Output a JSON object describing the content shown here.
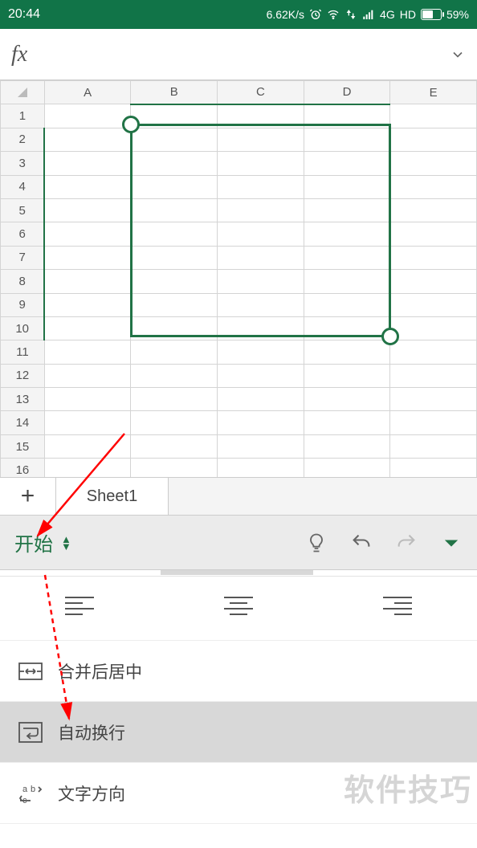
{
  "status": {
    "time": "20:44",
    "speed": "6.62K/s",
    "network": "4G",
    "hd": "HD",
    "battery_pct": "59%"
  },
  "formula_bar": {
    "fx_label": "fx"
  },
  "grid": {
    "columns": [
      "A",
      "B",
      "C",
      "D",
      "E"
    ],
    "rows": [
      "1",
      "2",
      "3",
      "4",
      "5",
      "6",
      "7",
      "8",
      "9",
      "10",
      "11",
      "12",
      "13",
      "14",
      "15",
      "16"
    ],
    "selected_cols": [
      "B",
      "C",
      "D"
    ],
    "selected_rows": [
      "2",
      "3",
      "4",
      "5",
      "6",
      "7",
      "8",
      "9",
      "10"
    ],
    "shaded_cell": "B2"
  },
  "sheets": {
    "add_icon": "+",
    "current": "Sheet1"
  },
  "ribbon": {
    "tab_label": "开始",
    "lightbulb": "tell-me",
    "undo": "undo",
    "redo": "redo",
    "dropdown": "more"
  },
  "panel": {
    "merge_center": "合并后居中",
    "wrap_text": "自动换行",
    "text_direction": "文字方向"
  },
  "watermark": "软件技巧"
}
